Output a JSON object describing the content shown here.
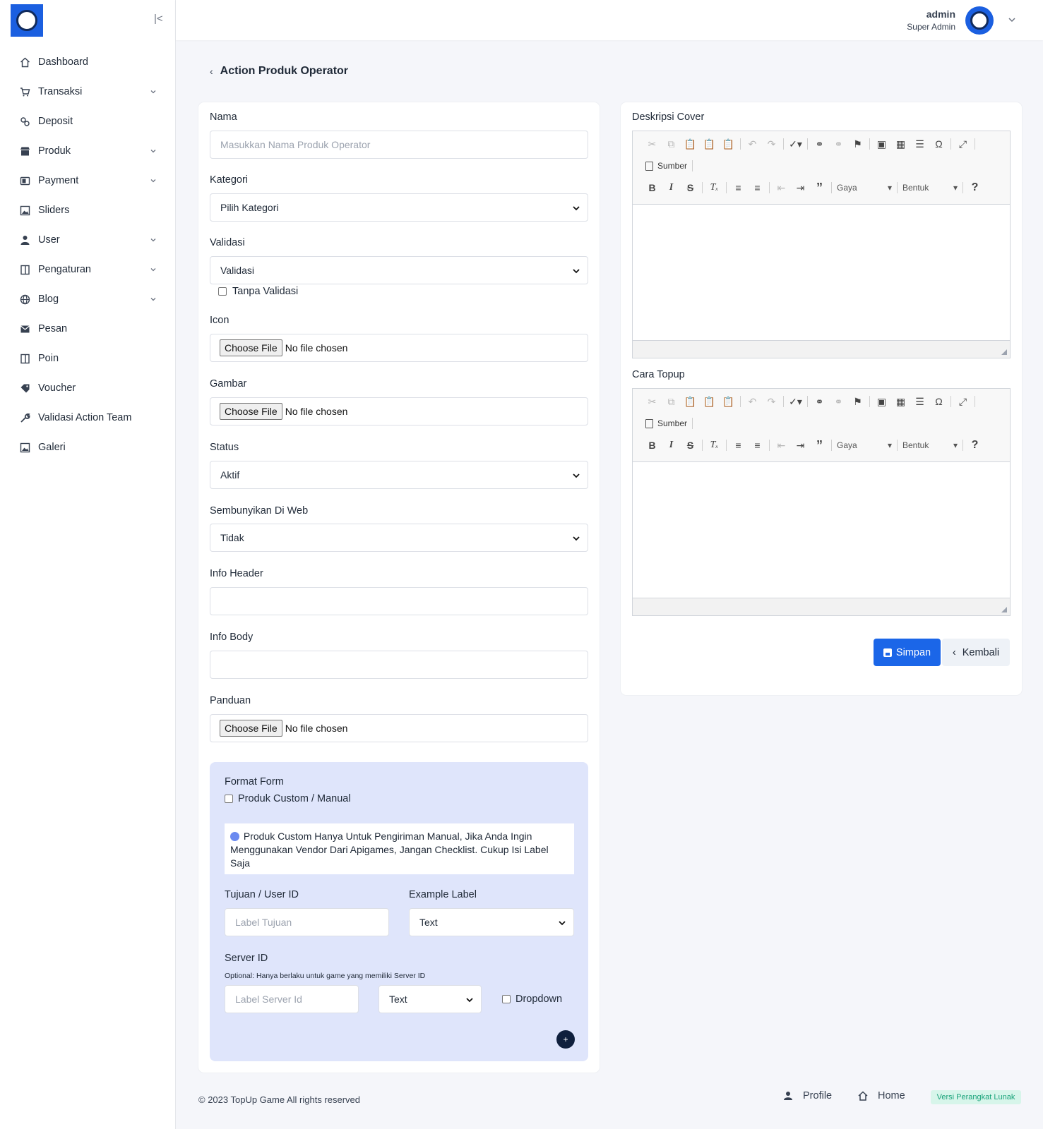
{
  "topbar": {
    "user_name": "admin",
    "user_role": "Super Admin"
  },
  "sidebar": {
    "items": [
      {
        "label": "Dashboard",
        "icon": "home-icon",
        "has_children": false
      },
      {
        "label": "Transaksi",
        "icon": "cart-icon",
        "has_children": true
      },
      {
        "label": "Deposit",
        "icon": "coins-icon",
        "has_children": false
      },
      {
        "label": "Produk",
        "icon": "store-icon",
        "has_children": true
      },
      {
        "label": "Payment",
        "icon": "wallet-icon",
        "has_children": true
      },
      {
        "label": "Sliders",
        "icon": "image-icon",
        "has_children": false
      },
      {
        "label": "User",
        "icon": "user-icon",
        "has_children": true
      },
      {
        "label": "Pengaturan",
        "icon": "window-icon",
        "has_children": true
      },
      {
        "label": "Blog",
        "icon": "globe-icon",
        "has_children": true
      },
      {
        "label": "Pesan",
        "icon": "mail-icon",
        "has_children": false
      },
      {
        "label": "Poin",
        "icon": "window-icon",
        "has_children": false
      },
      {
        "label": "Voucher",
        "icon": "tag-icon",
        "has_children": false
      },
      {
        "label": "Validasi Action Team",
        "icon": "wrench-icon",
        "has_children": false
      },
      {
        "label": "Galeri",
        "icon": "image-icon",
        "has_children": false
      }
    ]
  },
  "page": {
    "title": "Action Produk Operator"
  },
  "form": {
    "nama": {
      "label": "Nama",
      "placeholder": "Masukkan Nama Produk Operator"
    },
    "kategori": {
      "label": "Kategori",
      "value": "Pilih Kategori"
    },
    "validasi": {
      "label": "Validasi",
      "value": "Validasi",
      "checkbox_label": "Tanpa Validasi"
    },
    "icon": {
      "label": "Icon",
      "button": "Choose File",
      "text": "No file chosen"
    },
    "gambar": {
      "label": "Gambar",
      "button": "Choose File",
      "text": "No file chosen"
    },
    "status": {
      "label": "Status",
      "value": "Aktif"
    },
    "sembunyikan": {
      "label": "Sembunyikan Di Web",
      "value": "Tidak"
    },
    "info_header": {
      "label": "Info Header",
      "value": ""
    },
    "info_body": {
      "label": "Info Body",
      "value": ""
    },
    "panduan": {
      "label": "Panduan",
      "button": "Choose File",
      "text": "No file chosen"
    },
    "format_form": {
      "title": "Format Form",
      "checkbox_label": "Produk Custom / Manual",
      "info": "Produk Custom Hanya Untuk Pengiriman Manual, Jika Anda Ingin Menggunakan Vendor Dari Apigames, Jangan Checklist. Cukup Isi Label Saja",
      "tujuan_label": "Tujuan / User ID",
      "tujuan_placeholder": "Label Tujuan",
      "example_label": "Example Label",
      "example_value": "Text",
      "server_label": "Server ID",
      "server_note": "Optional: Hanya berlaku untuk game yang memiliki Server ID",
      "server_placeholder": "Label Server Id",
      "server_type_value": "Text",
      "dropdown_label": "Dropdown",
      "add_symbol": "+"
    }
  },
  "editors": {
    "deskripsi_label": "Deskripsi Cover",
    "cara_label": "Cara Topup",
    "source_label": "Sumber",
    "style_label": "Gaya",
    "format_label": "Bentuk",
    "help_symbol": "?"
  },
  "actions": {
    "save": "Simpan",
    "back": "Kembali"
  },
  "footer": {
    "copyright": "© 2023 TopUp Game All rights reserved",
    "profile": "Profile",
    "home": "Home",
    "version": "Versi Perangkat Lunak"
  },
  "colors": {
    "primary": "#1b66e8",
    "format_bg": "#dfe5fb",
    "version_bg": "#d7f5ea",
    "version_text": "#1aa37a"
  }
}
